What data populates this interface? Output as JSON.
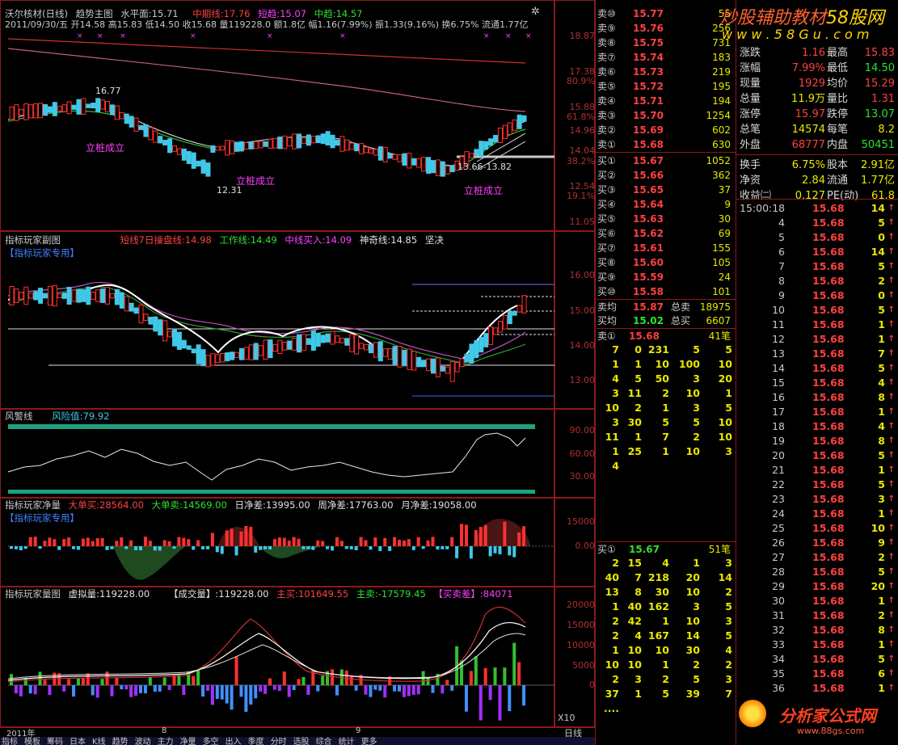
{
  "main": {
    "stock": "沃尔核材(日线)",
    "mode": "趋势主图",
    "water_label": "水平面:",
    "water_val": "15.71",
    "mid_line_label": "中期线:",
    "mid_line_val": "17.76",
    "short_trend_label": "短趋:",
    "short_trend_val": "15.07",
    "mid_trend_label": "中趋:",
    "mid_trend_val": "14.57",
    "ohlc": "2011/09/30/五 开14.58 高15.83 低14.50 收15.68 量119228.0 额1.8亿 幅1.16(7.99%) 振1.33(9.16%) 换6.75% 流通1.77亿",
    "y_labels": [
      "18.87",
      "17.38",
      "15.88",
      "14.96",
      "14.04",
      "12.54",
      "11.05"
    ],
    "pct_labels": [
      "80.9%",
      "61.8%",
      "38.2%",
      "19.1%"
    ],
    "annotations": {
      "high": "16.77",
      "low": "12.31",
      "mark": "13.66-13.82",
      "signal": "立桩成立"
    }
  },
  "sub1": {
    "title": "指标玩家副图",
    "tag": "【指标玩家专用】",
    "short_label": "短线7日操盘线:",
    "short_val": "14.98",
    "work_label": "工作线:",
    "work_val": "14.49",
    "mid_label": "中线买入:",
    "mid_val": "14.09",
    "god_label": "神奇线:",
    "god_val": "14.85",
    "decision": "坚决",
    "y_labels": [
      "16.00",
      "15.00",
      "14.00",
      "13.00"
    ]
  },
  "sub2": {
    "title": "风警线",
    "risk_label": "风险值:",
    "risk_val": "79.92",
    "y_labels": [
      "90.00",
      "60.00",
      "30.00"
    ]
  },
  "sub3": {
    "title": "指标玩家净量",
    "tag": "【指标玩家专用】",
    "big_buy_label": "大单买:",
    "big_buy_val": "28564.00",
    "big_sell_label": "大单卖:",
    "big_sell_val": "14569.00",
    "day_label": "日净差:",
    "day_val": "13995.00",
    "week_label": "周净差:",
    "week_val": "17763.00",
    "month_label": "月净差:",
    "month_val": "19058.00",
    "y_labels": [
      "15000",
      "0.00"
    ]
  },
  "sub4": {
    "title": "指标玩家量图",
    "virtual_label": "虚拟量:",
    "virtual_val": "119228.00",
    "deal_label": "【成交量】:",
    "deal_val": "119228.00",
    "main_buy_label": "主买:",
    "main_buy_val": "101649.55",
    "main_sell_label": "主卖:",
    "main_sell_val": "-17579.45",
    "diff_label": "【买卖差】:",
    "diff_val": "84071",
    "y_labels": [
      "20000",
      "15000",
      "10000",
      "5000",
      "0"
    ],
    "x10": "X10"
  },
  "xaxis": {
    "year": "2011年",
    "m8": "8",
    "m9": "9",
    "period": "日线"
  },
  "bottom_tabs": [
    "指标",
    "模板",
    "筹码",
    "日本",
    "K线",
    "趋势",
    "波动",
    "主力",
    "净量",
    "多空",
    "出入",
    "季度",
    "分时",
    "选股",
    "综合",
    "统计",
    "更多"
  ],
  "orderbook": {
    "sells": [
      {
        "label": "卖⑩",
        "price": "15.77",
        "vol": "55"
      },
      {
        "label": "卖⑨",
        "price": "15.76",
        "vol": "256"
      },
      {
        "label": "卖⑧",
        "price": "15.75",
        "vol": "731"
      },
      {
        "label": "卖⑦",
        "price": "15.74",
        "vol": "183"
      },
      {
        "label": "卖⑥",
        "price": "15.73",
        "vol": "219"
      },
      {
        "label": "卖⑤",
        "price": "15.72",
        "vol": "195"
      },
      {
        "label": "卖④",
        "price": "15.71",
        "vol": "194"
      },
      {
        "label": "卖③",
        "price": "15.70",
        "vol": "1254"
      },
      {
        "label": "卖②",
        "price": "15.69",
        "vol": "602"
      },
      {
        "label": "卖①",
        "price": "15.68",
        "vol": "630"
      }
    ],
    "buys": [
      {
        "label": "买①",
        "price": "15.67",
        "vol": "1052"
      },
      {
        "label": "买②",
        "price": "15.66",
        "vol": "362"
      },
      {
        "label": "买③",
        "price": "15.65",
        "vol": "37"
      },
      {
        "label": "买④",
        "price": "15.64",
        "vol": "9"
      },
      {
        "label": "买⑤",
        "price": "15.63",
        "vol": "30"
      },
      {
        "label": "买⑥",
        "price": "15.62",
        "vol": "69"
      },
      {
        "label": "买⑦",
        "price": "15.61",
        "vol": "155"
      },
      {
        "label": "买⑧",
        "price": "15.60",
        "vol": "105"
      },
      {
        "label": "买⑨",
        "price": "15.59",
        "vol": "24"
      },
      {
        "label": "买⑩",
        "price": "15.58",
        "vol": "101"
      }
    ],
    "sell_avg_label": "卖均",
    "sell_avg": "15.87",
    "total_sell_label": "总卖",
    "total_sell": "18975",
    "buy_avg_label": "买均",
    "buy_avg": "15.02",
    "total_buy_label": "总买",
    "total_buy": "6607",
    "sell1_head": {
      "label": "卖①",
      "price": "15.68",
      "count": "41笔"
    },
    "buy1_head": {
      "label": "买①",
      "price": "15.67",
      "count": "51笔"
    },
    "sell_queue": [
      [
        "7",
        "0",
        "231",
        "5",
        "5"
      ],
      [
        "1",
        "1",
        "10",
        "100",
        "10"
      ],
      [
        "4",
        "5",
        "50",
        "3",
        "20"
      ],
      [
        "3",
        "11",
        "2",
        "10",
        "1"
      ],
      [
        "10",
        "2",
        "1",
        "3",
        "5"
      ],
      [
        "3",
        "30",
        "5",
        "5",
        "10"
      ],
      [
        "11",
        "1",
        "7",
        "2",
        "10"
      ],
      [
        "1",
        "25",
        "1",
        "10",
        "3"
      ],
      [
        "4",
        "",
        "",
        "",
        ""
      ]
    ],
    "buy_queue": [
      [
        "2",
        "15",
        "4",
        "1",
        "3"
      ],
      [
        "40",
        "7",
        "218",
        "20",
        "14"
      ],
      [
        "13",
        "8",
        "30",
        "10",
        "2"
      ],
      [
        "1",
        "40",
        "162",
        "3",
        "5"
      ],
      [
        "2",
        "42",
        "1",
        "10",
        "3"
      ],
      [
        "2",
        "4",
        "167",
        "14",
        "5"
      ],
      [
        "1",
        "10",
        "10",
        "30",
        "4"
      ],
      [
        "10",
        "10",
        "1",
        "2",
        "2"
      ],
      [
        "2",
        "3",
        "2",
        "5",
        "3"
      ],
      [
        "37",
        "1",
        "5",
        "39",
        "7"
      ],
      [
        "....",
        "",
        "",
        "",
        ""
      ]
    ]
  },
  "watermark": {
    "title": "炒股辅助教材",
    "brand": "58股网",
    "url": "w w w . 5 8 G u . c o m",
    "logo": "分析家公式网",
    "logo_url": "www.88gs.com"
  },
  "stats": [
    {
      "k1": "涨跌",
      "v1": "1.16",
      "c1": "#ff4040",
      "k2": "最高",
      "v2": "15.83",
      "c2": "#ff4040"
    },
    {
      "k1": "涨幅",
      "v1": "7.99%",
      "c1": "#ff4040",
      "k2": "最低",
      "v2": "14.50",
      "c2": "#30e030"
    },
    {
      "k1": "现量",
      "v1": "1929",
      "c1": "#ff4040",
      "k2": "均价",
      "v2": "15.29",
      "c2": "#ff4040"
    },
    {
      "k1": "总量",
      "v1": "11.9万",
      "c1": "#e8e800",
      "k2": "量比",
      "v2": "1.31",
      "c2": "#ff4040"
    },
    {
      "k1": "涨停",
      "v1": "15.97",
      "c1": "#ff4040",
      "k2": "跌停",
      "v2": "13.07",
      "c2": "#30e030"
    },
    {
      "k1": "总笔",
      "v1": "14574",
      "c1": "#e8e800",
      "k2": "每笔",
      "v2": "8.2",
      "c2": "#e8e800"
    },
    {
      "k1": "外盘",
      "v1": "68777",
      "c1": "#ff4040",
      "k2": "内盘",
      "v2": "50451",
      "c2": "#30e030"
    },
    {
      "k1": "换手",
      "v1": "6.75%",
      "c1": "#e8e800",
      "k2": "股本",
      "v2": "2.91亿",
      "c2": "#e8e800"
    },
    {
      "k1": "净资",
      "v1": "2.84",
      "c1": "#e8e800",
      "k2": "流通",
      "v2": "1.77亿",
      "c2": "#e8e800"
    },
    {
      "k1": "收益㈡",
      "v1": "0.127",
      "c1": "#e8e800",
      "k2": "PE(动)",
      "v2": "61.8",
      "c2": "#e8e800"
    }
  ],
  "ticks": {
    "first_time": "15:00:18",
    "items": [
      {
        "t": "15:00:18",
        "v": "14"
      },
      {
        "t": "4",
        "v": "5"
      },
      {
        "t": "5",
        "v": "0"
      },
      {
        "t": "6",
        "v": "14"
      },
      {
        "t": "7",
        "v": "5"
      },
      {
        "t": "8",
        "v": "2"
      },
      {
        "t": "9",
        "v": "0"
      },
      {
        "t": "10",
        "v": "5"
      },
      {
        "t": "11",
        "v": "1"
      },
      {
        "t": "12",
        "v": "1"
      },
      {
        "t": "13",
        "v": "7"
      },
      {
        "t": "14",
        "v": "5"
      },
      {
        "t": "15",
        "v": "4"
      },
      {
        "t": "16",
        "v": "8"
      },
      {
        "t": "17",
        "v": "1"
      },
      {
        "t": "18",
        "v": "4"
      },
      {
        "t": "19",
        "v": "8"
      },
      {
        "t": "20",
        "v": "5"
      },
      {
        "t": "21",
        "v": "1"
      },
      {
        "t": "22",
        "v": "5"
      },
      {
        "t": "23",
        "v": "3"
      },
      {
        "t": "24",
        "v": "1"
      },
      {
        "t": "25",
        "v": "10"
      },
      {
        "t": "26",
        "v": "9"
      },
      {
        "t": "27",
        "v": "2"
      },
      {
        "t": "28",
        "v": "5"
      },
      {
        "t": "29",
        "v": "20"
      },
      {
        "t": "30",
        "v": "1"
      },
      {
        "t": "31",
        "v": "2"
      },
      {
        "t": "32",
        "v": "8"
      },
      {
        "t": "33",
        "v": "1"
      },
      {
        "t": "34",
        "v": "5"
      },
      {
        "t": "35",
        "v": "6"
      },
      {
        "t": "36",
        "v": "1"
      }
    ],
    "price": "15.68"
  },
  "colors": {
    "up": "#ff3030",
    "down": "#40c8e8",
    "grid": "#8b1a1a",
    "yellow": "#e8e800",
    "green": "#30e030",
    "magenta": "#ff40ff"
  }
}
